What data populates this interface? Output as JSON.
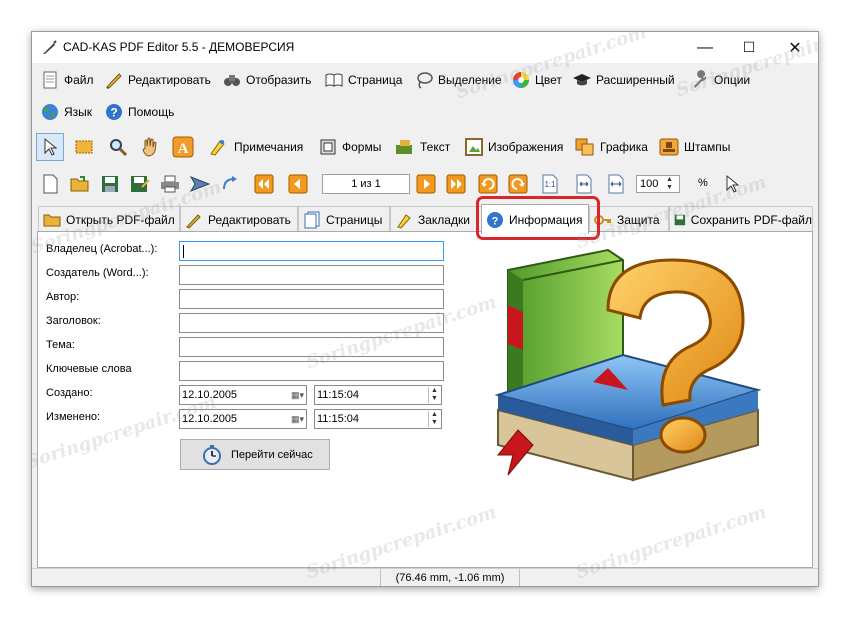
{
  "window": {
    "title": "CAD-KAS PDF Editor 5.5 - ДЕМОВЕРСИЯ",
    "controls": [
      "—",
      "☐",
      "✕"
    ]
  },
  "menu": {
    "row1": [
      "Файл",
      "Редактировать",
      "Отобразить",
      "Страница",
      "Выделение",
      "Цвет",
      "Расширенный",
      "Опции"
    ],
    "row2": [
      "Язык",
      "Помощь"
    ]
  },
  "toolbar1": {
    "notes": "Примечания",
    "forms": "Формы",
    "text": "Текст",
    "images": "Изображения",
    "graphics": "Графика",
    "stamps": "Штампы"
  },
  "toolbar2": {
    "page_indicator": "1 из 1",
    "fit_label": "1:1",
    "zoom_value": "100",
    "zoom_unit": "%"
  },
  "tabs": [
    "Открыть PDF-файл",
    "Редактировать",
    "Страницы",
    "Закладки",
    "Информация",
    "Защита",
    "Сохранить PDF-файл"
  ],
  "active_tab": "Информация",
  "form": {
    "owner_label": "Владелец (Acrobat...):",
    "creator_label": "Создатель (Word...):",
    "author_label": "Автор:",
    "title_label": "Заголовок:",
    "subject_label": "Тема:",
    "keywords_label": "Ключевые слова",
    "created_label": "Создано:",
    "modified_label": "Изменено:",
    "created_date": "12.10.2005",
    "created_time": "11:15:04",
    "modified_date": "12.10.2005",
    "modified_time": "11:15:04",
    "go_now": "Перейти сейчас"
  },
  "status": {
    "coords": "(76.46 mm, -1.06 mm)"
  },
  "watermark_text": "Soringpcrepair.com",
  "colors": {
    "highlight": "#d9262b",
    "book_green": "#7bbf3a",
    "book_blue": "#4c8fd6",
    "question_orange": "#f3a51e",
    "ribbon_red": "#c8161d"
  }
}
